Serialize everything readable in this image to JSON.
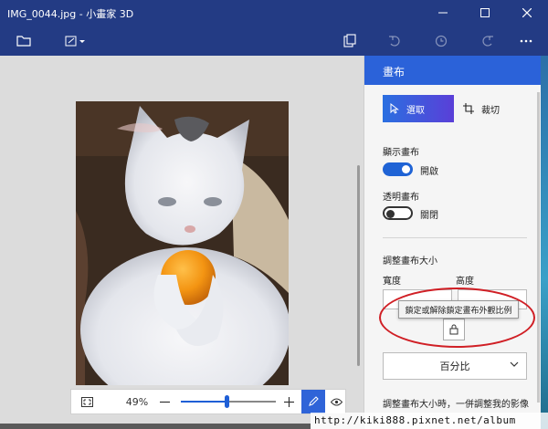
{
  "window": {
    "title": "IMG_0044.jpg - 小畫家 3D"
  },
  "colors": {
    "titlebar": "#233b84",
    "panel_header": "#2b62d9",
    "accent": "#1f63d5",
    "annotation": "#d01f25"
  },
  "toolbar": {
    "items": [
      "folder-icon",
      "resize-icon",
      "paste-icon",
      "undo-icon",
      "history-icon",
      "redo-icon",
      "more-icon"
    ]
  },
  "zoom": {
    "percent_label": "49%",
    "level": 0.49
  },
  "panel": {
    "title": "畫布",
    "select_label": "選取",
    "crop_label": "裁切",
    "show_canvas_label": "顯示畫布",
    "show_canvas_state": "開啟",
    "transparent_canvas_label": "透明畫布",
    "transparent_canvas_state": "關閉",
    "resize_canvas_label": "調整畫布大小",
    "width_label": "寬度",
    "height_label": "高度",
    "lock_tooltip": "鎖定或解除鎖定畫布外觀比例",
    "unit_dropdown": "百分比",
    "resize_image_with_canvas": "調整畫布大小時，一併調整我的影像"
  },
  "watermark": "http://kiki888.pixnet.net/album"
}
